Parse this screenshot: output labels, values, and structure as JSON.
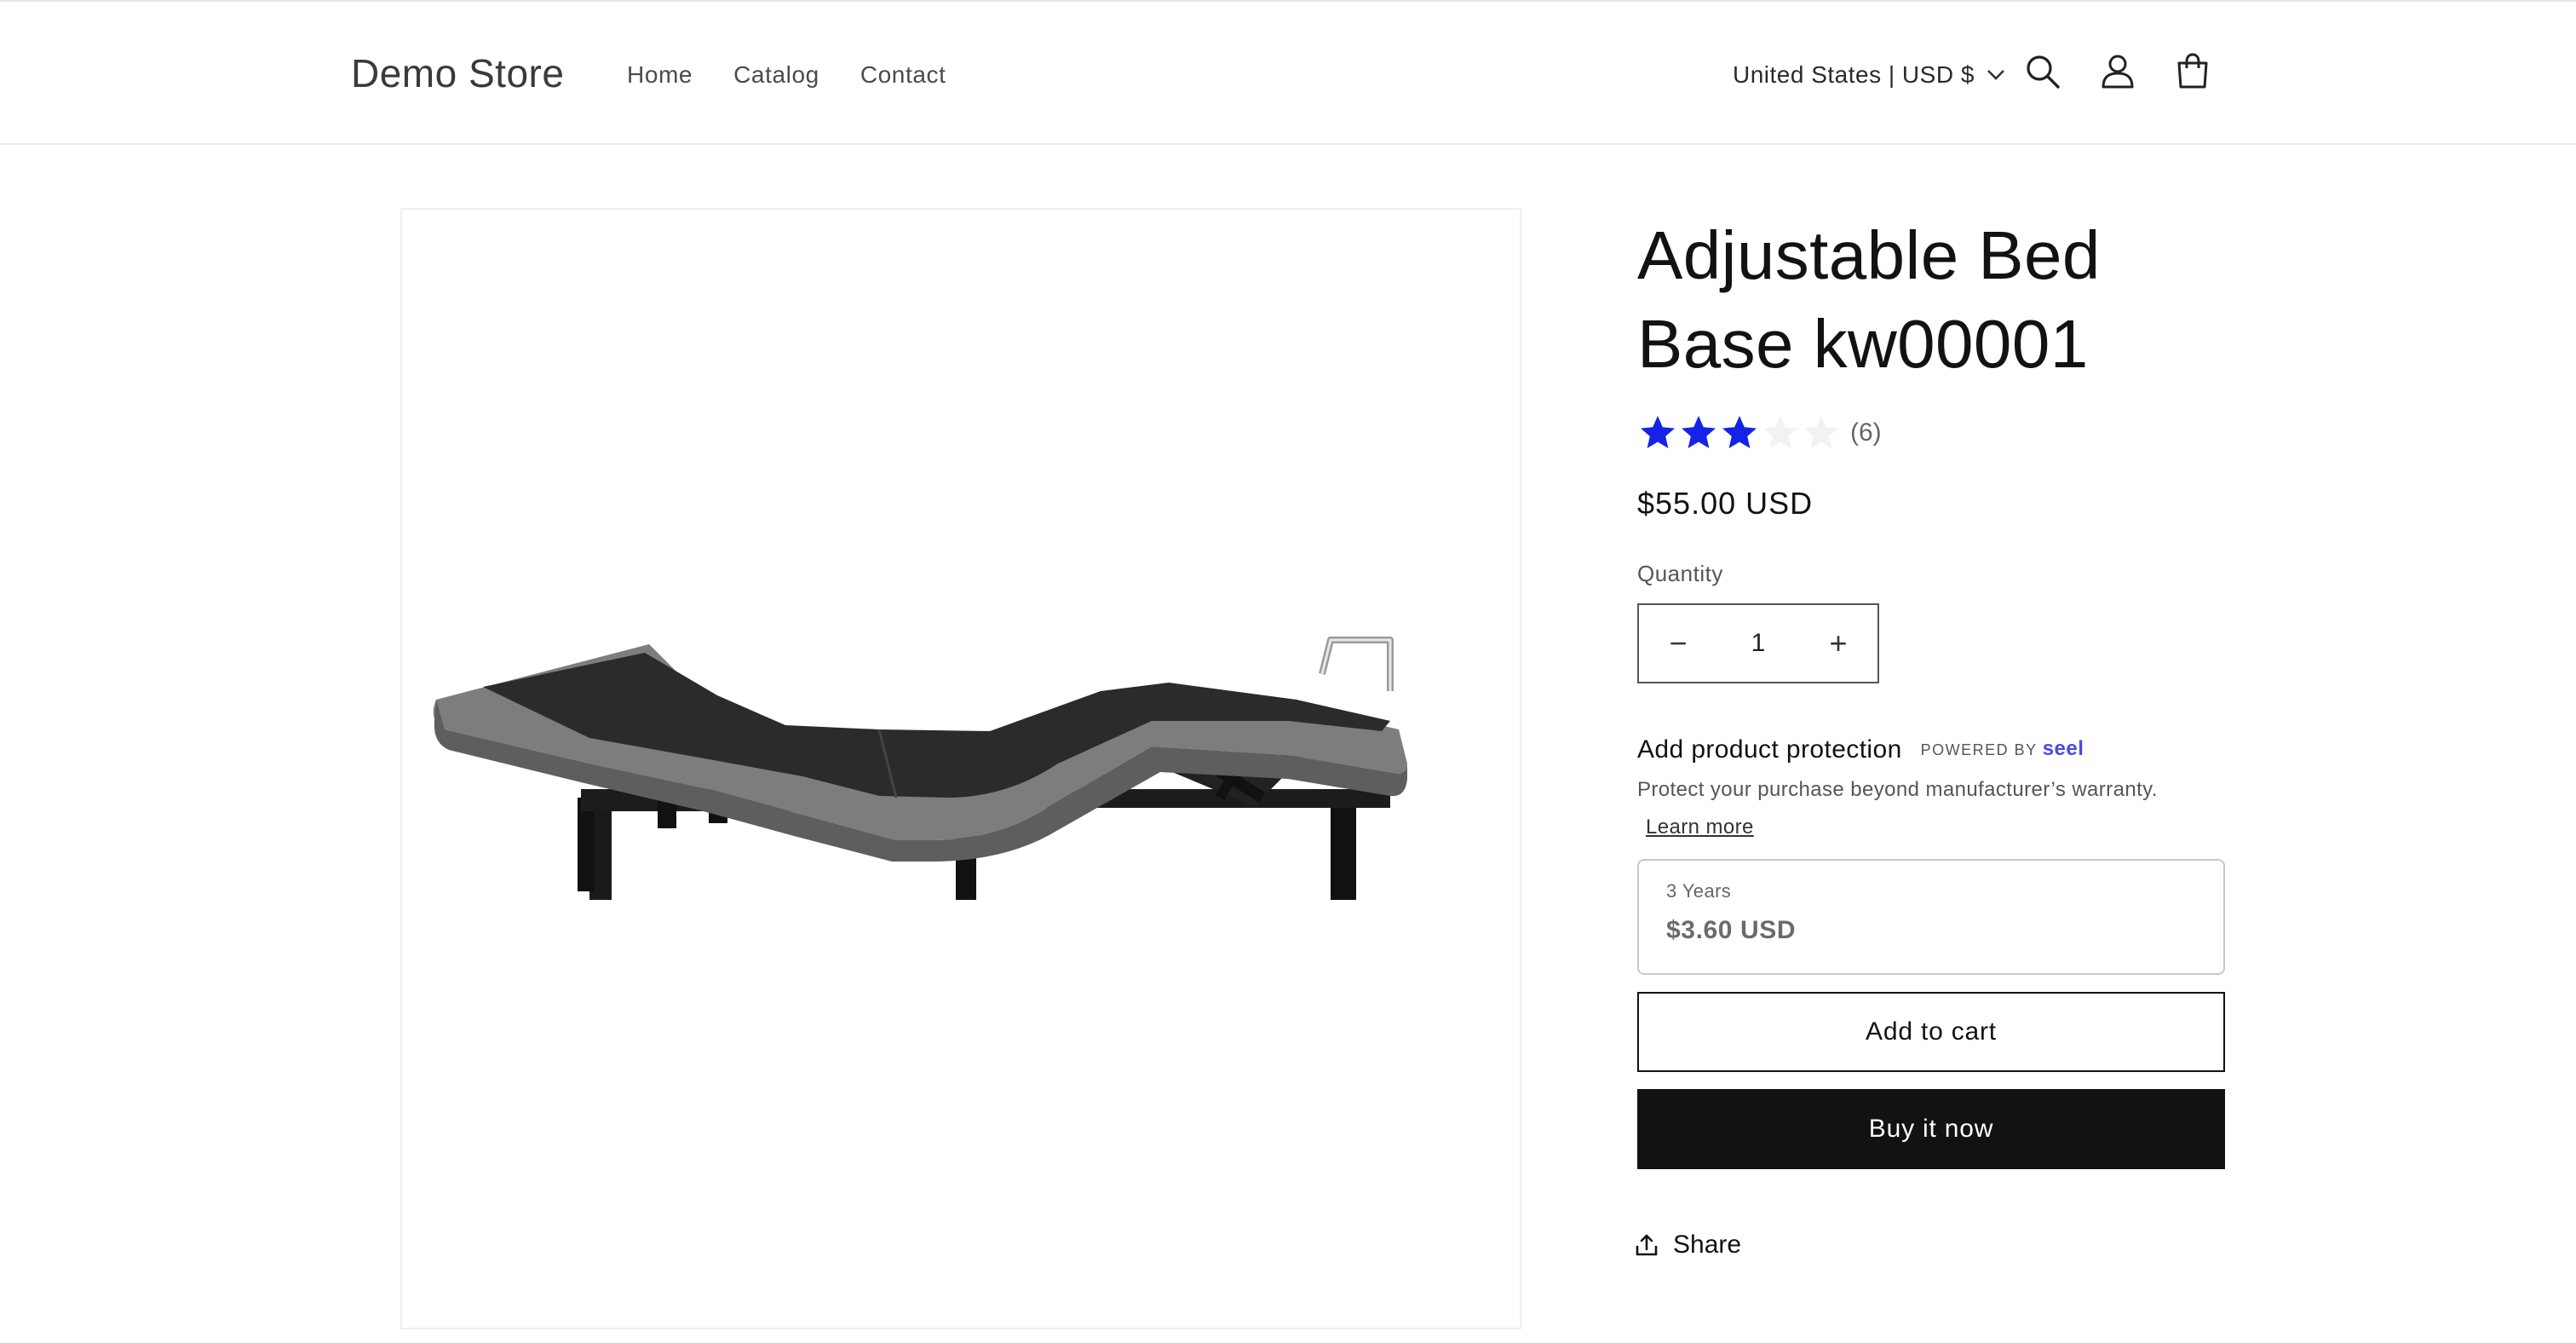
{
  "header": {
    "logo": "Demo Store",
    "nav": [
      "Home",
      "Catalog",
      "Contact"
    ],
    "locale": "United States | USD $",
    "icons": [
      "chevron-down-icon",
      "search-icon",
      "account-icon",
      "cart-icon"
    ]
  },
  "product": {
    "title": "Adjustable Bed Base kw00001",
    "rating": {
      "value": 3,
      "max": 5,
      "count_label": "(6)",
      "star_color": "#1522e8",
      "empty_color": "#f2f2f2"
    },
    "price": "$55.00 USD",
    "quantity_label": "Quantity",
    "quantity": "1",
    "decrease_symbol": "−",
    "increase_symbol": "+",
    "protection": {
      "title": "Add product protection",
      "powered_by": "POWERED BY",
      "brand": "seel",
      "description": "Protect your purchase beyond manufacturer’s warranty.",
      "learn_more": "Learn more",
      "plan_term": "3 Years",
      "plan_price": "$3.60 USD"
    },
    "add_to_cart": "Add to cart",
    "buy_now": "Buy it now",
    "share": "Share"
  },
  "colors": {
    "accent": "#121212",
    "seel_brand": "#4a49e6",
    "star": "#1522e8"
  }
}
